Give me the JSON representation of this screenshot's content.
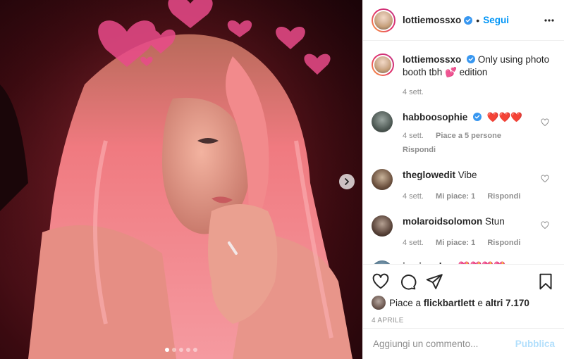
{
  "post": {
    "author": "lottiemossxo",
    "separator": "•",
    "follow_label": "Segui",
    "caption_text": "Only using photo booth tbh 💕 edition",
    "caption_time": "4 sett.",
    "carousel": {
      "slides": 5,
      "active": 1
    }
  },
  "comments": [
    {
      "user": "habboosophie",
      "verified": true,
      "text": "❤️❤️❤️",
      "time": "4 sett.",
      "likes": "Piace a 5 persone",
      "reply": "Rispondi"
    },
    {
      "user": "theglowedit",
      "verified": false,
      "text": "Vibe",
      "time": "4 sett.",
      "likes": "Mi piace: 1",
      "reply": "Rispondi"
    },
    {
      "user": "molaroidsolomon",
      "verified": false,
      "text": "Stun",
      "time": "4 sett.",
      "likes": "Mi piace: 1",
      "reply": "Rispondi"
    },
    {
      "user": "jemimarhys",
      "verified": false,
      "text": "💖💖💖💖",
      "time": "",
      "likes": "",
      "reply": ""
    }
  ],
  "likes": {
    "prefix": "Piace a",
    "user": "flickbartlett",
    "middle": "e",
    "others": "altri 7.170"
  },
  "post_date": "4 APRILE",
  "add_comment": {
    "placeholder": "Aggiungi un commento...",
    "publish_label": "Pubblica"
  },
  "colors": {
    "link_blue": "#0095f6",
    "publish_disabled": "#b2dffc",
    "verified_blue": "#3897f0",
    "muted_text": "#8e8e8e"
  },
  "icons": [
    "heart-icon",
    "comment-icon",
    "share-icon",
    "bookmark-icon",
    "more-icon",
    "verified-icon",
    "chevron-right-icon"
  ]
}
